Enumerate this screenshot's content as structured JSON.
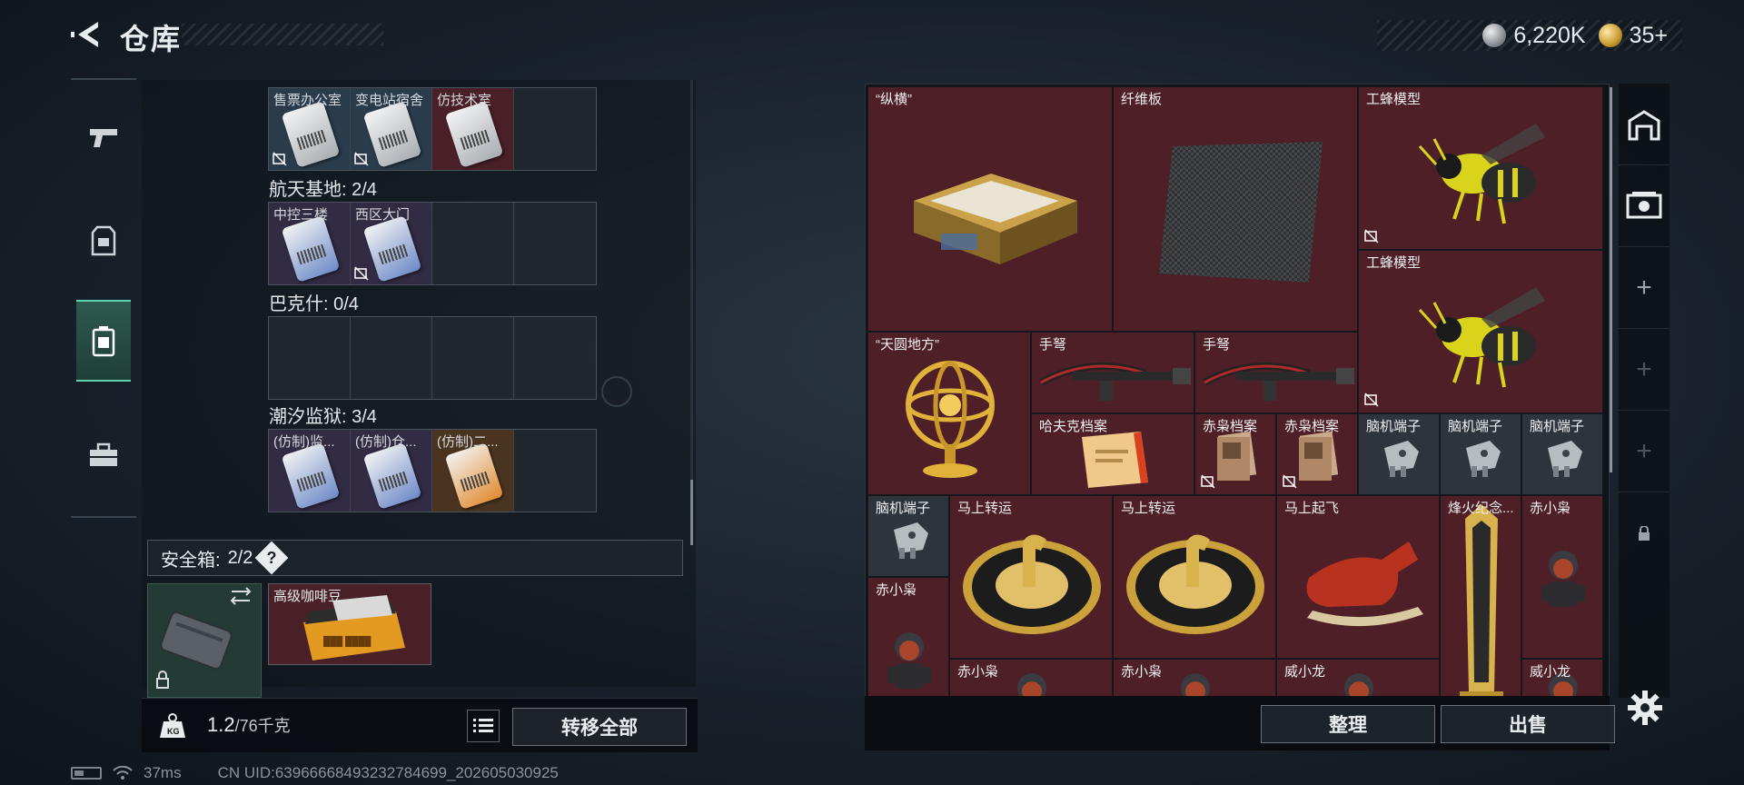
{
  "header": {
    "title": "仓库",
    "currency": [
      {
        "icon": "silver-coin-icon",
        "value": "6,220K"
      },
      {
        "icon": "gold-coin-icon",
        "value": "35+"
      }
    ]
  },
  "left_tabs": [
    {
      "icon": "pistol-icon",
      "active": false
    },
    {
      "icon": "armor-vest-icon",
      "active": false
    },
    {
      "icon": "backpack-icon",
      "active": true
    },
    {
      "icon": "toolbox-icon",
      "active": false
    }
  ],
  "collections": {
    "row0": {
      "cells": [
        {
          "label": "售票办公室",
          "restricted": true,
          "color": "blue"
        },
        {
          "label": "变电站宿舍",
          "restricted": true,
          "color": "blue"
        },
        {
          "label": "仿技术室",
          "restricted": false,
          "color": "red"
        },
        {
          "label": "",
          "restricted": false,
          "color": "empty"
        }
      ]
    },
    "sec1": {
      "title": "航天基地: 2/4",
      "cells": [
        {
          "label": "中控三楼",
          "restricted": false,
          "color": "purple"
        },
        {
          "label": "西区大门",
          "restricted": true,
          "color": "purple"
        },
        {
          "label": "",
          "restricted": false,
          "color": "empty"
        },
        {
          "label": "",
          "restricted": false,
          "color": "empty"
        }
      ]
    },
    "sec2": {
      "title": "巴克什: 0/4",
      "cells": [
        {
          "label": "",
          "restricted": false,
          "color": "empty"
        },
        {
          "label": "",
          "restricted": false,
          "color": "empty"
        },
        {
          "label": "",
          "restricted": false,
          "color": "empty"
        },
        {
          "label": "",
          "restricted": false,
          "color": "empty"
        }
      ]
    },
    "sec3": {
      "title": "潮汐监狱: 3/4",
      "cells": [
        {
          "label": "(仿制)监...",
          "restricted": false,
          "color": "purple"
        },
        {
          "label": "(仿制)仓...",
          "restricted": false,
          "color": "purple"
        },
        {
          "label": "(仿制)二...",
          "restricted": false,
          "color": "brown"
        },
        {
          "label": "",
          "restricted": false,
          "color": "empty"
        }
      ]
    }
  },
  "safe_box": {
    "label": "安全箱:",
    "count": "2/2",
    "help": "?",
    "item_label": "高级咖啡豆"
  },
  "left_footer": {
    "weight_current": "1.2",
    "weight_max": "/76千克",
    "transfer_all": "转移全部"
  },
  "inventory": {
    "items": [
      {
        "label": "“纵横”",
        "restricted": false,
        "color": "red",
        "art": "chess-board"
      },
      {
        "label": "纤维板",
        "restricted": false,
        "color": "red",
        "art": "carbon-plate"
      },
      {
        "label": "工蜂模型",
        "restricted": true,
        "color": "red",
        "art": "bee-model"
      },
      {
        "label": "工蜂模型",
        "restricted": true,
        "color": "red",
        "art": "bee-model"
      },
      {
        "label": "“天圆地方”",
        "restricted": false,
        "color": "red",
        "art": "armillary-sphere"
      },
      {
        "label": "手弩",
        "restricted": false,
        "color": "red",
        "art": "crossbow"
      },
      {
        "label": "手弩",
        "restricted": false,
        "color": "red",
        "art": "crossbow"
      },
      {
        "label": "哈夫克档案",
        "restricted": false,
        "color": "red",
        "art": "document"
      },
      {
        "label": "赤枭档案",
        "restricted": true,
        "color": "red",
        "art": "dossier"
      },
      {
        "label": "赤枭档案",
        "restricted": true,
        "color": "red",
        "art": "dossier"
      },
      {
        "label": "脑机端子",
        "restricted": false,
        "color": "gray",
        "art": "neural-plug"
      },
      {
        "label": "脑机端子",
        "restricted": false,
        "color": "gray",
        "art": "neural-plug"
      },
      {
        "label": "脑机端子",
        "restricted": false,
        "color": "gray",
        "art": "neural-plug"
      },
      {
        "label": "脑机端子",
        "restricted": false,
        "color": "gray",
        "art": "neural-plug"
      },
      {
        "label": "马上转运",
        "restricted": false,
        "color": "red",
        "art": "horse-plate"
      },
      {
        "label": "马上转运",
        "restricted": false,
        "color": "red",
        "art": "horse-plate"
      },
      {
        "label": "马上起飞",
        "restricted": false,
        "color": "red",
        "art": "red-horse"
      },
      {
        "label": "烽火纪念...",
        "restricted": false,
        "color": "red",
        "art": "trophy"
      },
      {
        "label": "赤小枭",
        "restricted": false,
        "color": "red",
        "art": "figure"
      },
      {
        "label": "赤小枭",
        "restricted": false,
        "color": "red",
        "art": "figure"
      },
      {
        "label": "赤小枭",
        "restricted": false,
        "color": "red",
        "art": "figure"
      },
      {
        "label": "赤小枭",
        "restricted": false,
        "color": "red",
        "art": "figure"
      },
      {
        "label": "威小龙",
        "restricted": false,
        "color": "red",
        "art": "figure"
      },
      {
        "label": "威小龙",
        "restricted": false,
        "color": "red",
        "art": "figure"
      }
    ]
  },
  "inventory_footer": {
    "organize": "整理",
    "sell": "出售"
  },
  "right_rail": [
    {
      "icon": "warehouse-icon",
      "enabled": true
    },
    {
      "icon": "expansion-box-icon",
      "enabled": true
    },
    {
      "icon": "add-icon",
      "enabled": true
    },
    {
      "icon": "add-icon",
      "enabled": false
    },
    {
      "icon": "add-icon",
      "enabled": false
    },
    {
      "icon": "lock-icon",
      "enabled": false
    }
  ],
  "status_bar": {
    "ping": "37ms",
    "uid": "CN UID:6396666849323278469​9_202605030925"
  },
  "colors": {
    "accent_green": "#5fd3b0",
    "rarity_red": "#4e1f26",
    "rarity_purple": "#342c48",
    "rarity_blue": "#2a3b4b",
    "rarity_gray": "#2e343b"
  }
}
